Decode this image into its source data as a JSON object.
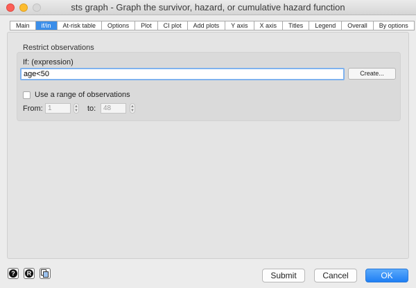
{
  "window": {
    "title": "sts graph - Graph the survivor, hazard, or cumulative hazard function"
  },
  "tabs": [
    {
      "label": "Main",
      "active": false
    },
    {
      "label": "if/in",
      "active": true
    },
    {
      "label": "At-risk table",
      "active": false
    },
    {
      "label": "Options",
      "active": false
    },
    {
      "label": "Plot",
      "active": false
    },
    {
      "label": "CI plot",
      "active": false
    },
    {
      "label": "Add plots",
      "active": false
    },
    {
      "label": "Y axis",
      "active": false
    },
    {
      "label": "X axis",
      "active": false
    },
    {
      "label": "Titles",
      "active": false
    },
    {
      "label": "Legend",
      "active": false
    },
    {
      "label": "Overall",
      "active": false
    },
    {
      "label": "By options",
      "active": false
    }
  ],
  "restrict": {
    "group_title": "Restrict observations",
    "if_label": "If: (expression)",
    "if_value": "age<50",
    "create_label": "Create...",
    "range_checkbox_label": "Use a range of observations",
    "range_checked": false,
    "from_label": "From:",
    "from_value": "1",
    "to_label": "to:",
    "to_value": "48"
  },
  "footer": {
    "help_icon": "question-icon",
    "reset_icon": "r-icon",
    "copy_icon": "copy-icon",
    "submit_label": "Submit",
    "cancel_label": "Cancel",
    "ok_label": "OK"
  },
  "colors": {
    "accent": "#3b8ee9",
    "ok_button": "#1f7ff4"
  }
}
